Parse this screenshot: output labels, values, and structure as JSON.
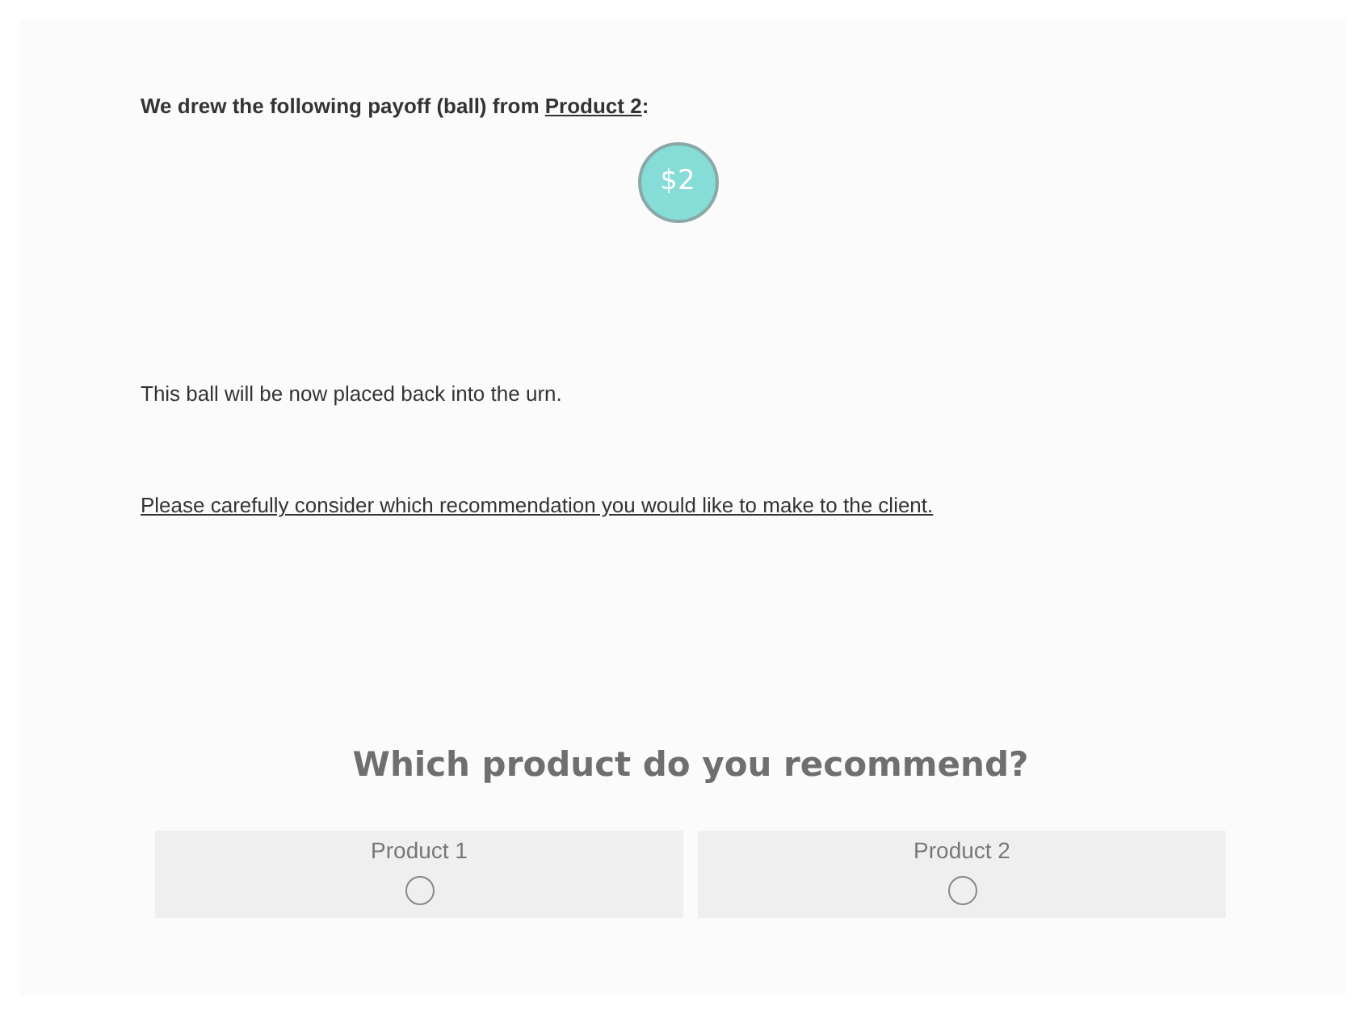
{
  "draw_statement": {
    "prefix": "We drew the following payoff (ball) from ",
    "product": "Product 2",
    "suffix": ":"
  },
  "ball": {
    "label": "$2",
    "color": "#86dcd6"
  },
  "placed_back_text": "This ball will be now placed back into the urn.",
  "consider_text": "Please carefully consider which recommendation you would like to make to the client.",
  "question": "Which product do you recommend?",
  "options": [
    {
      "label": "Product 1",
      "selected": false
    },
    {
      "label": "Product 2",
      "selected": false
    }
  ]
}
